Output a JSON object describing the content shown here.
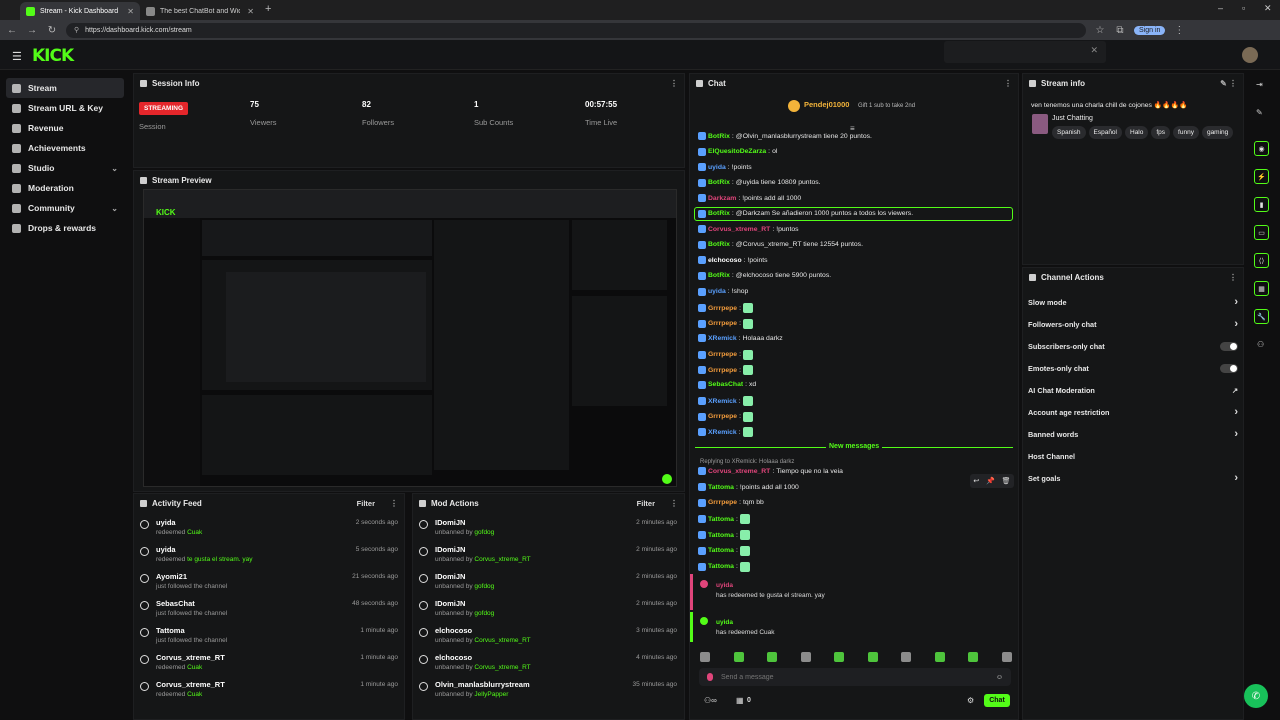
{
  "browser": {
    "tabs": [
      {
        "label": "Stream - Kick Dashboard"
      },
      {
        "label": "The best ChatBot and Widge..."
      }
    ],
    "url": "https://dashboard.kick.com/stream",
    "signin": "Sign in"
  },
  "app": {
    "logo": "KICK"
  },
  "sidebar": {
    "items": [
      {
        "label": "Stream"
      },
      {
        "label": "Stream URL & Key"
      },
      {
        "label": "Revenue"
      },
      {
        "label": "Achievements"
      },
      {
        "label": "Studio"
      },
      {
        "label": "Moderation"
      },
      {
        "label": "Community"
      },
      {
        "label": "Drops & rewards"
      }
    ]
  },
  "session": {
    "title": "Session Info",
    "status": "STREAMING",
    "status_sub": "Session",
    "stats": [
      {
        "value": "75",
        "label": "Viewers"
      },
      {
        "value": "82",
        "label": "Followers"
      },
      {
        "value": "1",
        "label": "Sub Counts"
      },
      {
        "value": "00:57:55",
        "label": "Time Live"
      }
    ]
  },
  "preview": {
    "title": "Stream Preview"
  },
  "activity": {
    "title": "Activity Feed",
    "filter": "Filter",
    "rows": [
      {
        "name": "uyida",
        "sub": "redeemed",
        "hl": "Cuak",
        "time": "2 seconds ago"
      },
      {
        "name": "uyida",
        "sub": "redeemed",
        "hl": "te gusta el stream. yay",
        "time": "5 seconds ago"
      },
      {
        "name": "Ayomi21",
        "sub": "just followed the channel",
        "hl": "",
        "time": "21 seconds ago"
      },
      {
        "name": "SebasChat",
        "sub": "just followed the channel",
        "hl": "",
        "time": "48 seconds ago"
      },
      {
        "name": "Tattoma",
        "sub": "just followed the channel",
        "hl": "",
        "time": "1 minute ago"
      },
      {
        "name": "Corvus_xtreme_RT",
        "sub": "redeemed",
        "hl": "Cuak",
        "time": "1 minute ago"
      },
      {
        "name": "Corvus_xtreme_RT",
        "sub": "redeemed",
        "hl": "Cuak",
        "time": "1 minute ago"
      }
    ]
  },
  "mod": {
    "title": "Mod Actions",
    "filter": "Filter",
    "rows": [
      {
        "name": "IDomiJN",
        "sub": "unbanned by",
        "hl": "gofdog",
        "time": "2 minutes ago"
      },
      {
        "name": "IDomiJN",
        "sub": "unbanned by",
        "hl": "Corvus_xtreme_RT",
        "time": "2 minutes ago"
      },
      {
        "name": "IDomiJN",
        "sub": "unbanned by",
        "hl": "gofdog",
        "time": "2 minutes ago"
      },
      {
        "name": "IDomiJN",
        "sub": "unbanned by",
        "hl": "gofdog",
        "time": "2 minutes ago"
      },
      {
        "name": "elchocoso",
        "sub": "unbanned by",
        "hl": "Corvus_xtreme_RT",
        "time": "3 minutes ago"
      },
      {
        "name": "elchocoso",
        "sub": "unbanned by",
        "hl": "Corvus_xtreme_RT",
        "time": "4 minutes ago"
      },
      {
        "name": "Olvin_manlasblurrystream",
        "sub": "unbanned by",
        "hl": "JellyPapper",
        "time": "35 minutes ago"
      }
    ]
  },
  "chat": {
    "title": "Chat",
    "pinned_user": "Pendej01000",
    "pinned_text": "Gift 1 sub to take 2nd",
    "messages": [
      {
        "user": "BotRix",
        "color": "#53fc18",
        "text": "@Olvin_manlasblurrystream tiene 20 puntos."
      },
      {
        "user": "ElQuesitoDeZarza",
        "color": "#53fc18",
        "text": "ol"
      },
      {
        "user": "uyida",
        "color": "#5aa0ff",
        "text": "!points"
      },
      {
        "user": "BotRix",
        "color": "#53fc18",
        "text": "@uyida tiene 10809 puntos."
      },
      {
        "user": "Darkzam",
        "color": "#e0457b",
        "text": "!points add all 1000"
      },
      {
        "user": "BotRix",
        "color": "#53fc18",
        "text": "@Darkzam Se añadieron 1000 puntos a todos los viewers."
      },
      {
        "user": "Corvus_xtreme_RT",
        "color": "#e0457b",
        "text": "!puntos"
      },
      {
        "user": "BotRix",
        "color": "#53fc18",
        "text": "@Corvus_xtreme_RT tiene 12554 puntos."
      },
      {
        "user": "elchocoso",
        "color": "#ffffff",
        "text": "!points"
      },
      {
        "user": "BotRix",
        "color": "#53fc18",
        "text": "@elchocoso tiene 5900 puntos."
      },
      {
        "user": "uyida",
        "color": "#5aa0ff",
        "text": "!shop"
      },
      {
        "user": "Grrrpepe",
        "color": "#f39c3c",
        "text": ""
      },
      {
        "user": "Grrrpepe",
        "color": "#f39c3c",
        "text": ""
      },
      {
        "user": "XRemick",
        "color": "#5aa0ff",
        "text": "Holaaa darkz"
      },
      {
        "user": "Grrrpepe",
        "color": "#f39c3c",
        "text": ""
      },
      {
        "user": "Grrrpepe",
        "color": "#f39c3c",
        "text": ""
      },
      {
        "user": "SebasChat",
        "color": "#53fc18",
        "text": "xd"
      },
      {
        "user": "XRemick",
        "color": "#5aa0ff",
        "text": ""
      },
      {
        "user": "Grrrpepe",
        "color": "#f39c3c",
        "text": ""
      },
      {
        "user": "XRemick",
        "color": "#5aa0ff",
        "text": ""
      }
    ],
    "new_messages": "New messages",
    "reply_ctx": "Replying to XRemick: Holaaa darkz",
    "reply_user": "Corvus_xtreme_RT",
    "reply_text": "Tiempo que no la veia",
    "after": [
      {
        "user": "Tattoma",
        "color": "#53fc18",
        "text": "!points add all 1000"
      },
      {
        "user": "Grrrpepe",
        "color": "#f39c3c",
        "text": "tqm bb"
      },
      {
        "user": "Tattoma",
        "color": "#53fc18",
        "text": ""
      },
      {
        "user": "Tattoma",
        "color": "#53fc18",
        "text": ""
      },
      {
        "user": "Tattoma",
        "color": "#53fc18",
        "text": ""
      },
      {
        "user": "Tattoma",
        "color": "#53fc18",
        "text": ""
      }
    ],
    "redeems": [
      {
        "user": "uyida",
        "text": "has redeemed te gusta el stream. yay"
      },
      {
        "user": "uyida",
        "text": "has redeemed Cuak"
      }
    ],
    "placeholder": "Send a message",
    "count": "0",
    "send": "Chat"
  },
  "streaminfo": {
    "title": "Stream info",
    "stream_title": "ven tenemos una charla chill de cojones",
    "category": "Just Chatting",
    "tags": [
      "Spanish",
      "Español",
      "Halo",
      "fps",
      "funny",
      "gaming"
    ]
  },
  "actions": {
    "title": "Channel Actions",
    "items": [
      {
        "label": "Slow mode",
        "kind": "arrow"
      },
      {
        "label": "Followers-only chat",
        "kind": "arrow"
      },
      {
        "label": "Subscribers-only chat",
        "kind": "toggle"
      },
      {
        "label": "Emotes-only chat",
        "kind": "toggle"
      },
      {
        "label": "AI Chat Moderation",
        "kind": "ext"
      },
      {
        "label": "Account age restriction",
        "kind": "arrow"
      },
      {
        "label": "Banned words",
        "kind": "arrow"
      },
      {
        "label": "Host Channel",
        "kind": "none"
      },
      {
        "label": "Set goals",
        "kind": "arrow"
      }
    ]
  },
  "colors": {
    "accent": "#53fc18",
    "streaming": "#e5262b"
  }
}
